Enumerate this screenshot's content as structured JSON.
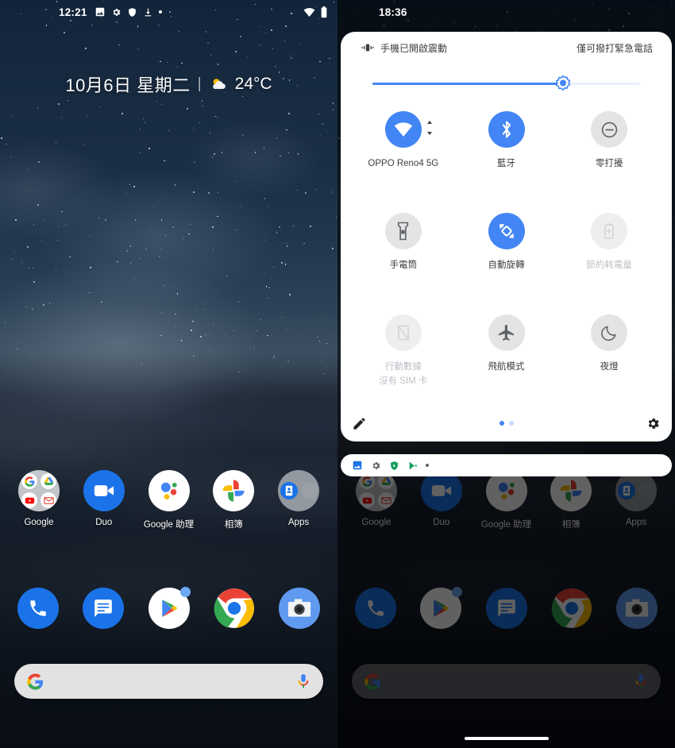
{
  "left_phone": {
    "status_bar": {
      "clock": "12:21",
      "icons": [
        "image-icon",
        "gear-icon",
        "shield-icon",
        "download-icon",
        "overflow-dot"
      ],
      "right_icons": [
        "wifi-icon",
        "battery-icon"
      ]
    },
    "date_widget": {
      "date": "10月6日 星期二",
      "separator": "|",
      "temperature": "24°C",
      "weather_icon": "sun-behind-cloud-icon"
    },
    "app_row": [
      {
        "label": "Google",
        "icon": "google-folder"
      },
      {
        "label": "Duo",
        "icon": "duo-icon"
      },
      {
        "label": "Google 助理",
        "icon": "assistant-icon"
      },
      {
        "label": "相簿",
        "icon": "photos-icon"
      },
      {
        "label": "Apps",
        "icon": "apps-folder"
      }
    ],
    "dock": [
      {
        "label": "Phone",
        "icon": "phone-icon"
      },
      {
        "label": "Messages",
        "icon": "messages-icon"
      },
      {
        "label": "Play Store",
        "icon": "play-store-icon"
      },
      {
        "label": "Chrome",
        "icon": "chrome-icon"
      },
      {
        "label": "Camera",
        "icon": "camera-icon"
      }
    ],
    "search": {
      "placeholder": "",
      "value": "",
      "left_icon": "google-g-icon",
      "right_icon": "microphone-icon"
    }
  },
  "right_phone": {
    "status_bar": {
      "clock": "18:36"
    },
    "shade": {
      "vibrate_text": "手機已開啟震動",
      "vibrate_icon": "vibrate-icon",
      "carrier_text": "僅可撥打緊急電話",
      "brightness": {
        "percent": 71,
        "thumb_icon": "brightness-sun-icon"
      },
      "tiles": [
        {
          "label": "OPPO Reno4 5G",
          "sub": "",
          "icon": "wifi-icon",
          "state": "on",
          "expandable": true
        },
        {
          "label": "藍牙",
          "sub": "",
          "icon": "bluetooth-icon",
          "state": "on",
          "expandable": false
        },
        {
          "label": "零打擾",
          "sub": "",
          "icon": "do-not-disturb-icon",
          "state": "off",
          "expandable": false
        },
        {
          "label": "手電筒",
          "sub": "",
          "icon": "flashlight-icon",
          "state": "off",
          "expandable": false
        },
        {
          "label": "自動旋轉",
          "sub": "",
          "icon": "auto-rotate-icon",
          "state": "on",
          "expandable": false
        },
        {
          "label": "節約耗電量",
          "sub": "",
          "icon": "battery-saver-icon",
          "state": "disabled",
          "expandable": false
        },
        {
          "label": "行動數據",
          "sub": "沒有 SIM 卡",
          "icon": "mobile-data-off-icon",
          "state": "disabled",
          "expandable": false
        },
        {
          "label": "飛航模式",
          "sub": "",
          "icon": "airplane-icon",
          "state": "off",
          "expandable": false
        },
        {
          "label": "夜燈",
          "sub": "",
          "icon": "night-light-icon",
          "state": "off",
          "expandable": false
        }
      ],
      "footer": {
        "edit_icon": "pencil-icon",
        "settings_icon": "gear-icon",
        "pages": 2,
        "active_page": 1
      }
    },
    "notification_bar": {
      "icons": [
        "image-icon",
        "gear-icon",
        "play-protect-icon",
        "play-store-icon"
      ],
      "overflow": "overflow-dot"
    },
    "home": {
      "app_row": [
        {
          "label": "Google"
        },
        {
          "label": "Duo"
        },
        {
          "label": "Google 助理"
        },
        {
          "label": "相簿"
        },
        {
          "label": "Apps"
        }
      ],
      "dock": [
        {
          "label": "Phone",
          "icon": "phone-icon"
        },
        {
          "label": "Play Store",
          "icon": "play-store-icon"
        },
        {
          "label": "Messages",
          "icon": "messages-icon"
        },
        {
          "label": "Chrome",
          "icon": "chrome-icon"
        },
        {
          "label": "Camera",
          "icon": "camera-icon"
        }
      ]
    },
    "nav_bar": {
      "type": "gesture-handle"
    }
  },
  "colors": {
    "accent_blue": "#4285f4",
    "tile_off": "#e4e4e4",
    "text_primary": "#3c4043",
    "text_disabled": "#bdc1c6"
  }
}
